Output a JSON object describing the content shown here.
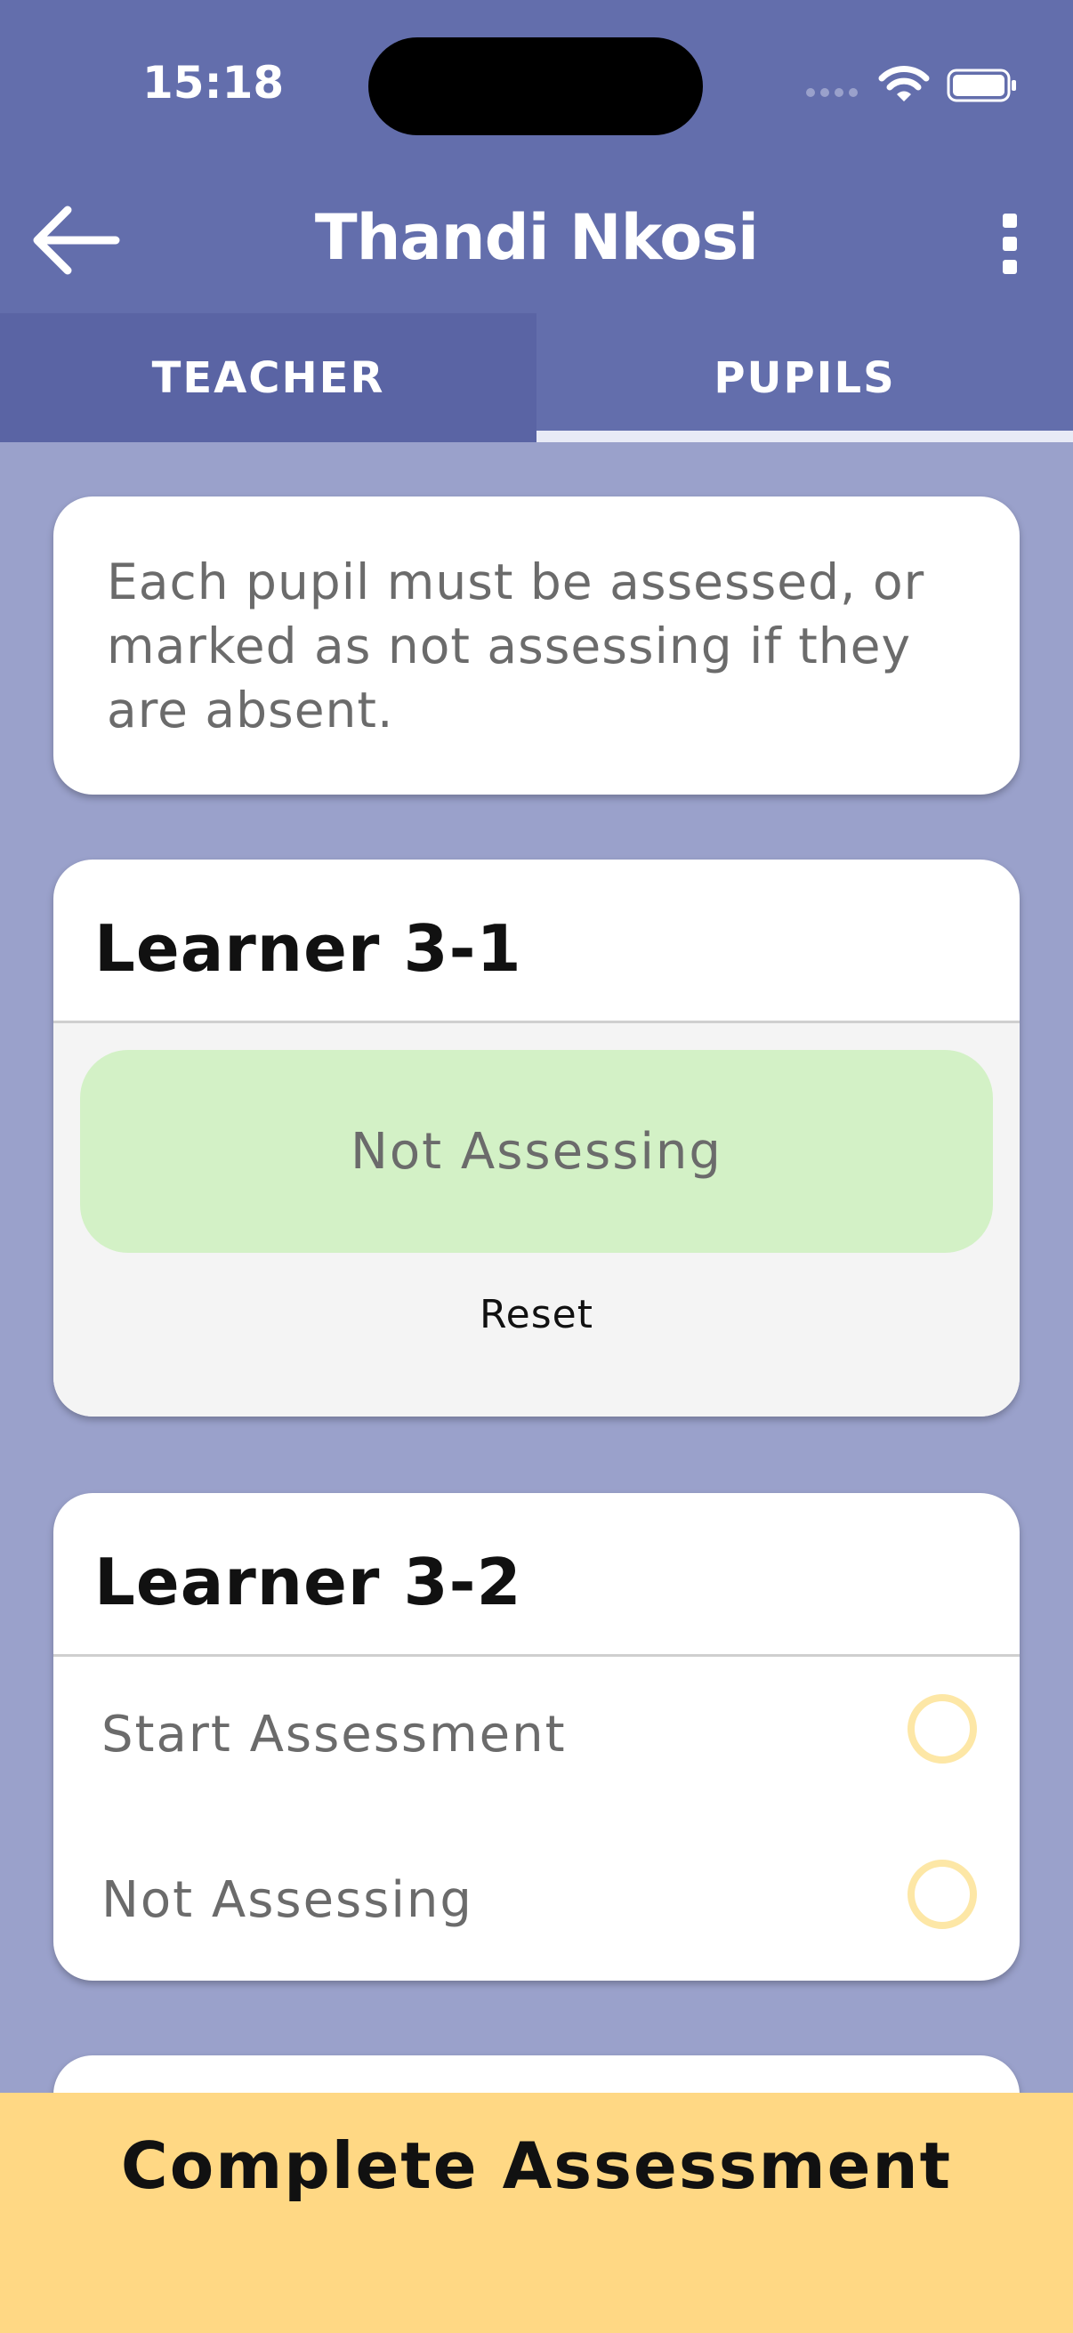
{
  "status_bar": {
    "time": "15:18"
  },
  "header": {
    "title": "Thandi Nkosi"
  },
  "tabs": [
    {
      "label": "TEACHER",
      "active": false
    },
    {
      "label": "PUPILS",
      "active": true
    }
  ],
  "info": {
    "text": "Each pupil must be assessed, or marked as not assessing if they are absent."
  },
  "learners": [
    {
      "name": "Learner 3-1",
      "status": "Not Assessing",
      "reset_label": "Reset"
    },
    {
      "name": "Learner 3-2",
      "options": [
        {
          "label": "Start Assessment"
        },
        {
          "label": "Not Assessing"
        }
      ]
    }
  ],
  "footer": {
    "complete_label": "Complete Assessment"
  },
  "colors": {
    "header": "#636eac",
    "background": "#9aa1cb",
    "chip_green": "#d3f1c6",
    "radio_yellow": "#fde7a6",
    "footer_yellow": "#ffd884"
  }
}
